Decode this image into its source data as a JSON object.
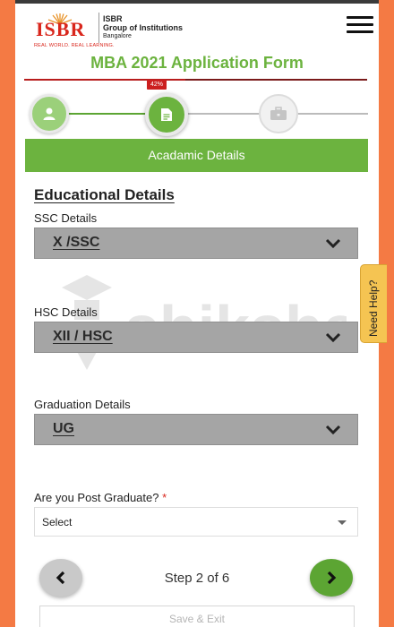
{
  "header": {
    "logo_word": "ISBR",
    "logo_tagline": "REAL WORLD. REAL LEARNING.",
    "institution_line1": "ISBR",
    "institution_line2": "Group of Institutions",
    "institution_line3": "Bangalore"
  },
  "form": {
    "title": "MBA 2021 Application Form",
    "progress_percent": 42,
    "progress_label": "42%",
    "steps": [
      {
        "icon": "user-icon",
        "state": "completed"
      },
      {
        "icon": "document-icon",
        "state": "current"
      },
      {
        "icon": "briefcase-icon",
        "state": "upcoming"
      }
    ],
    "section_title": "Acadamic Details"
  },
  "education": {
    "heading": "Educational Details",
    "ssc": {
      "label": "SSC Details",
      "value": "X /SSC"
    },
    "hsc": {
      "label": "HSC Details",
      "value": "XII / HSC"
    },
    "graduation": {
      "label": "Graduation Details",
      "value": "UG"
    },
    "post_grad": {
      "label": "Are you Post Graduate?",
      "required_mark": "*",
      "selected": "Select"
    }
  },
  "watermark": {
    "text": "shiksha"
  },
  "navigation": {
    "step_text": "Step 2 of 6",
    "save_exit_label": "Save & Exit"
  },
  "help_tab": {
    "label": "Need Help?"
  },
  "colors": {
    "brand_green": "#6cb33f",
    "brand_red": "#d9261c",
    "side_orange": "#f47a44",
    "help_yellow": "#f5c452"
  }
}
